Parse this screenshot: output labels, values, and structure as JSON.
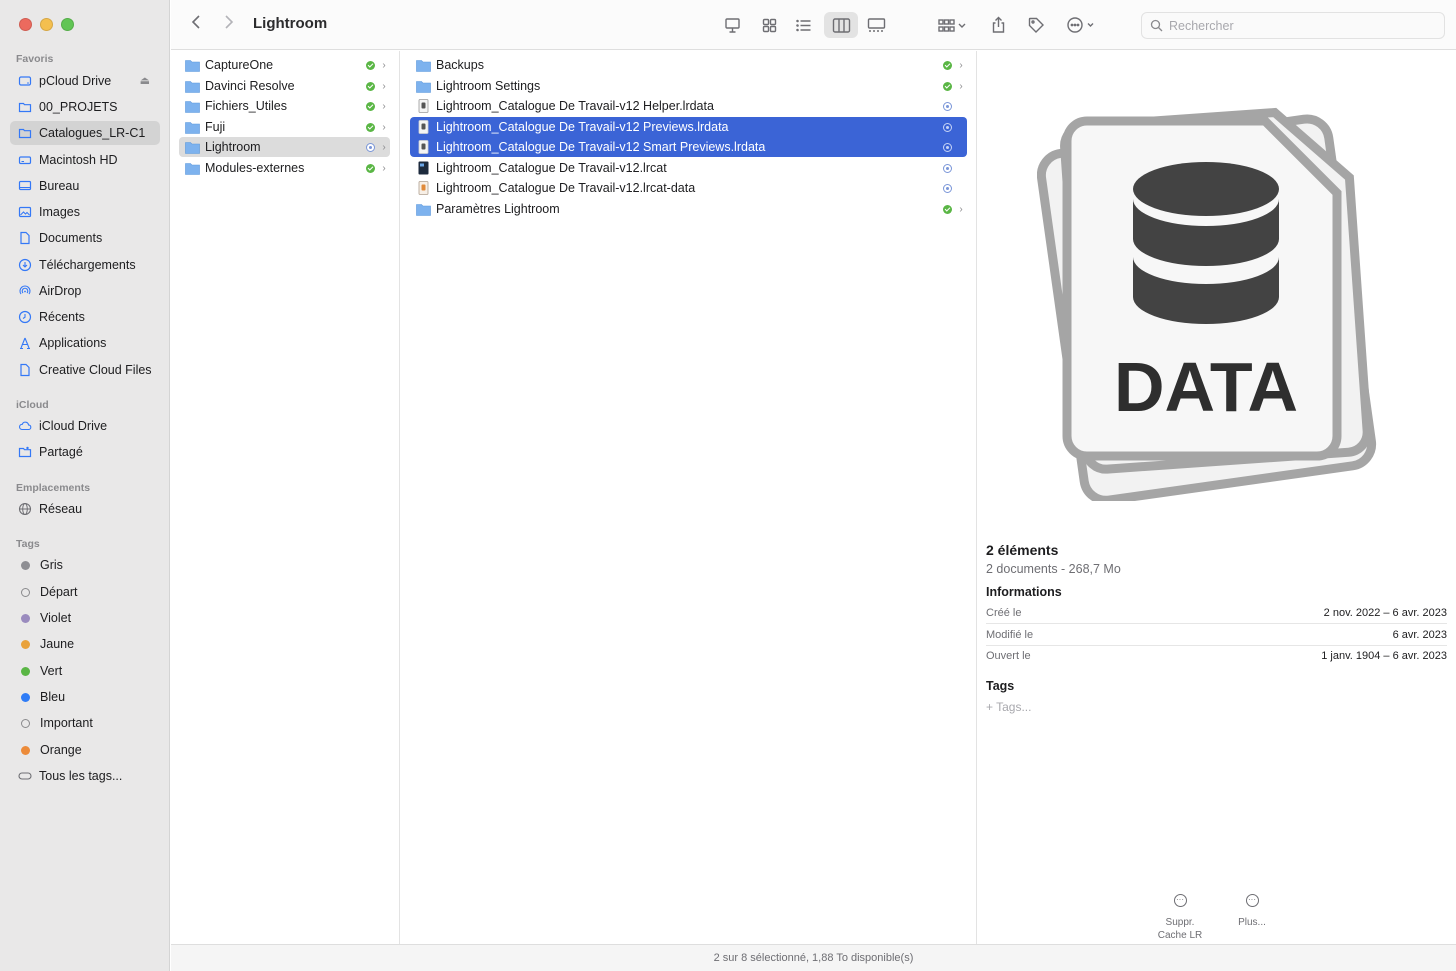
{
  "window": {
    "title": "Lightroom"
  },
  "toolbar": {
    "search_placeholder": "Rechercher"
  },
  "sidebar": {
    "favorites_header": "Favoris",
    "favorites": [
      {
        "label": "pCloud Drive",
        "icon": "drive-icon"
      },
      {
        "label": "00_PROJETS",
        "icon": "folder-icon"
      },
      {
        "label": "Catalogues_LR-C1",
        "icon": "folder-icon"
      },
      {
        "label": "Macintosh HD",
        "icon": "harddisk-icon"
      },
      {
        "label": "Bureau",
        "icon": "desktop-icon"
      },
      {
        "label": "Images",
        "icon": "photo-icon"
      },
      {
        "label": "Documents",
        "icon": "document-icon"
      },
      {
        "label": "Téléchargements",
        "icon": "download-icon"
      },
      {
        "label": "AirDrop",
        "icon": "airdrop-icon"
      },
      {
        "label": "Récents",
        "icon": "clock-icon"
      },
      {
        "label": "Applications",
        "icon": "applications-icon"
      },
      {
        "label": "Creative Cloud Files",
        "icon": "document-icon"
      }
    ],
    "icloud_header": "iCloud",
    "icloud": [
      {
        "label": "iCloud Drive",
        "icon": "cloud-icon"
      },
      {
        "label": "Partagé",
        "icon": "shared-folder-icon"
      }
    ],
    "locations_header": "Emplacements",
    "locations": [
      {
        "label": "Réseau",
        "icon": "network-icon"
      }
    ],
    "tags_header": "Tags",
    "tags": [
      {
        "label": "Gris",
        "color": "#8e8e93"
      },
      {
        "label": "Départ",
        "color": "none"
      },
      {
        "label": "Violet",
        "color": "#9a8bbe"
      },
      {
        "label": "Jaune",
        "color": "#e9a23b"
      },
      {
        "label": "Vert",
        "color": "#5ab645"
      },
      {
        "label": "Bleu",
        "color": "#2f7cf6"
      },
      {
        "label": "Important",
        "color": "none"
      },
      {
        "label": "Orange",
        "color": "#ec8b3a"
      },
      {
        "label": "Tous les tags...",
        "color": "all"
      }
    ]
  },
  "column1": [
    {
      "name": "CaptureOne",
      "status": "synced"
    },
    {
      "name": "Davinci Resolve",
      "status": "synced"
    },
    {
      "name": "Fichiers_Utiles",
      "status": "synced"
    },
    {
      "name": "Fuji",
      "status": "synced"
    },
    {
      "name": "Lightroom",
      "status": "cloud"
    },
    {
      "name": "Modules-externes",
      "status": "synced"
    }
  ],
  "column2": [
    {
      "name": "Backups",
      "type": "folder",
      "status": "synced"
    },
    {
      "name": "Lightroom Settings",
      "type": "folder",
      "status": "synced"
    },
    {
      "name": "Lightroom_Catalogue De Travail-v12 Helper.lrdata",
      "type": "file",
      "status": "cloud"
    },
    {
      "name": "Lightroom_Catalogue De Travail-v12 Previews.lrdata",
      "type": "file",
      "status": "cloud"
    },
    {
      "name": "Lightroom_Catalogue De Travail-v12 Smart Previews.lrdata",
      "type": "file",
      "status": "cloud"
    },
    {
      "name": "Lightroom_Catalogue De Travail-v12.lrcat",
      "type": "lrcat",
      "status": "cloud"
    },
    {
      "name": "Lightroom_Catalogue De Travail-v12.lrcat-data",
      "type": "lrcatdata",
      "status": "cloud"
    },
    {
      "name": "Paramètres Lightroom",
      "type": "folder",
      "status": "synced"
    }
  ],
  "preview": {
    "icon_text": "DATA",
    "title": "2 éléments",
    "subtitle": "2 documents - 268,7 Mo",
    "info_header": "Informations",
    "info": [
      {
        "key": "Créé le",
        "value": "2 nov. 2022 – 6 avr. 2023"
      },
      {
        "key": "Modifié le",
        "value": "6 avr. 2023"
      },
      {
        "key": "Ouvert le",
        "value": "1 janv. 1904 – 6 avr. 2023"
      }
    ],
    "tags_header": "Tags",
    "tags_placeholder": "+ Tags...",
    "actions": [
      {
        "label_line1": "Suppr.",
        "label_line2": "Cache LR"
      },
      {
        "label_line1": "Plus...",
        "label_line2": ""
      }
    ]
  },
  "statusbar": {
    "text": "2 sur 8 sélectionné, 1,88 To disponible(s)"
  }
}
